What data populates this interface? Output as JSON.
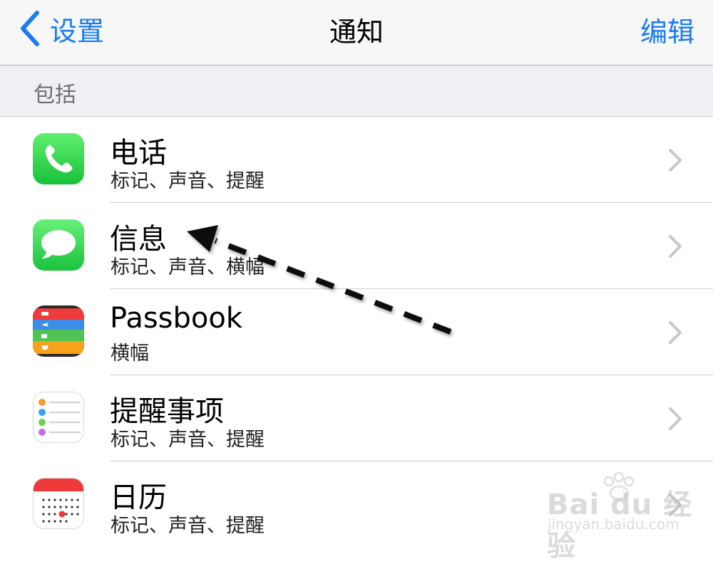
{
  "navbar": {
    "back_label": "设置",
    "title": "通知",
    "edit_label": "编辑"
  },
  "section": {
    "header": "包括"
  },
  "apps": [
    {
      "name": "电话",
      "detail": "标记、声音、提醒",
      "icon": "phone-icon"
    },
    {
      "name": "信息",
      "detail": "标记、声音、横幅",
      "icon": "messages-icon"
    },
    {
      "name": "Passbook",
      "detail": "横幅",
      "icon": "passbook-icon"
    },
    {
      "name": "提醒事项",
      "detail": "标记、声音、提醒",
      "icon": "reminders-icon"
    },
    {
      "name": "日历",
      "detail": "标记、声音、提醒",
      "icon": "calendar-icon"
    }
  ],
  "watermark": {
    "brand": "Bai du 经验",
    "url": "jingyan.baidu.com"
  },
  "colors": {
    "accent": "#1a7cf3",
    "section_bg": "#efeff4",
    "navbar_bg": "#f7f7f8"
  }
}
